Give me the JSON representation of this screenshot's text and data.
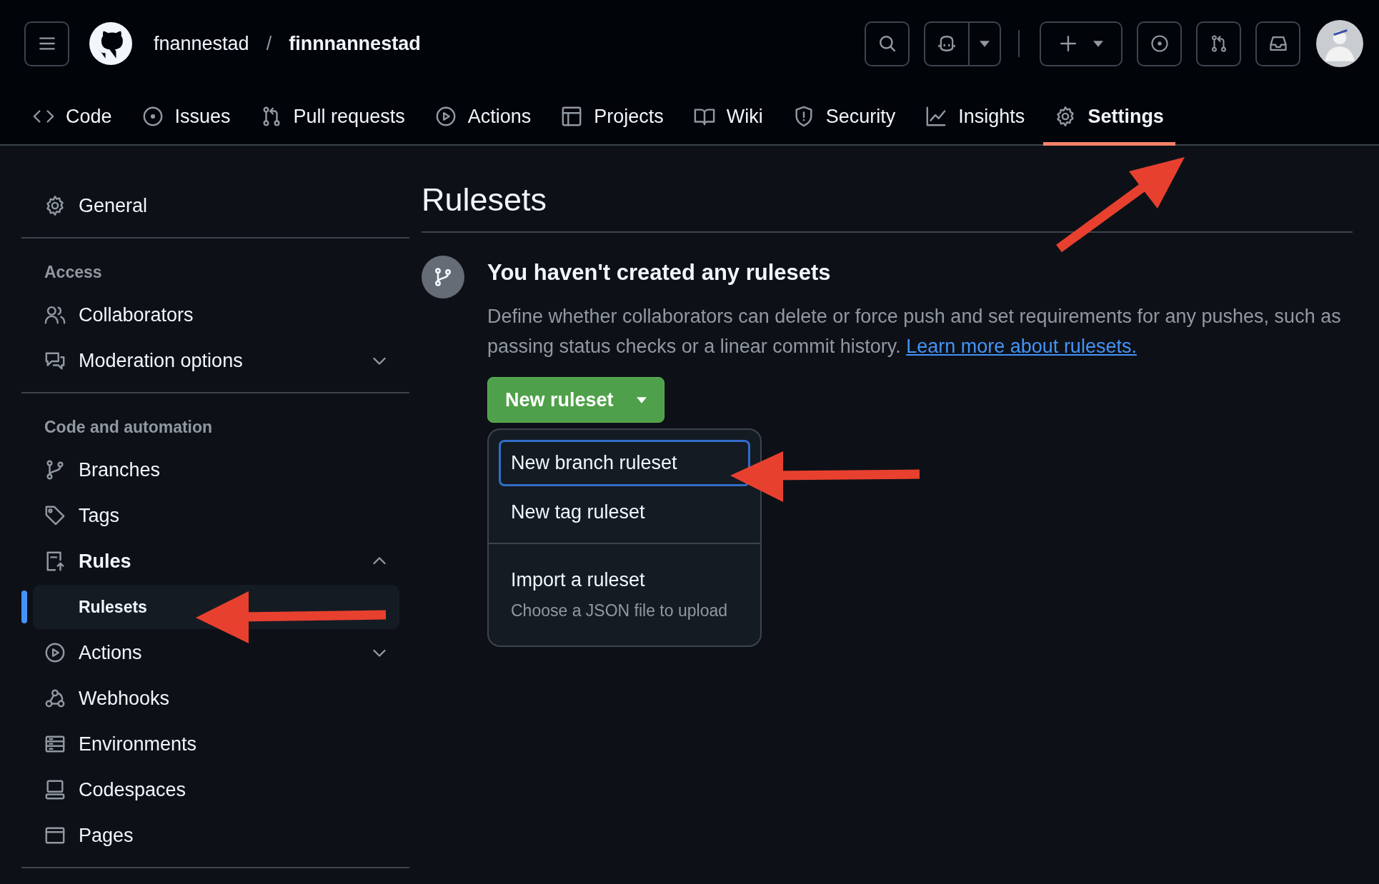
{
  "header": {
    "owner": "fnannestad",
    "separator": "/",
    "repo": "finnnannestad"
  },
  "tabs": [
    {
      "label": "Code",
      "selected": false
    },
    {
      "label": "Issues",
      "selected": false
    },
    {
      "label": "Pull requests",
      "selected": false
    },
    {
      "label": "Actions",
      "selected": false
    },
    {
      "label": "Projects",
      "selected": false
    },
    {
      "label": "Wiki",
      "selected": false
    },
    {
      "label": "Security",
      "selected": false
    },
    {
      "label": "Insights",
      "selected": false
    },
    {
      "label": "Settings",
      "selected": true
    }
  ],
  "sidebar": {
    "sections": [
      {
        "items": [
          {
            "label": "General",
            "selected": false
          }
        ]
      },
      {
        "heading": "Access",
        "items": [
          {
            "label": "Collaborators",
            "selected": false
          },
          {
            "label": "Moderation options",
            "selected": false,
            "expanded": false
          }
        ]
      },
      {
        "heading": "Code and automation",
        "items": [
          {
            "label": "Branches",
            "selected": false
          },
          {
            "label": "Tags",
            "selected": false
          },
          {
            "label": "Rules",
            "selected": false,
            "expanded": true,
            "children": [
              {
                "label": "Rulesets",
                "selected": true
              }
            ]
          },
          {
            "label": "Actions",
            "selected": false,
            "expanded": false
          },
          {
            "label": "Webhooks",
            "selected": false
          },
          {
            "label": "Environments",
            "selected": false
          },
          {
            "label": "Codespaces",
            "selected": false
          },
          {
            "label": "Pages",
            "selected": false
          }
        ]
      }
    ]
  },
  "main": {
    "title": "Rulesets",
    "empty_heading": "You haven't created any rulesets",
    "description": "Define whether collaborators can delete or force push and set requirements for any pushes, such as passing status checks or a linear commit history.",
    "link": "Learn more about rulesets.",
    "button": "New ruleset",
    "menu": [
      {
        "items": [
          {
            "label": "New branch ruleset",
            "selected": true
          },
          {
            "label": "New tag ruleset",
            "selected": false
          }
        ]
      },
      {
        "items": [
          {
            "label": "Import a ruleset",
            "description": "Choose a JSON file to upload",
            "selected": false
          }
        ]
      }
    ]
  }
}
